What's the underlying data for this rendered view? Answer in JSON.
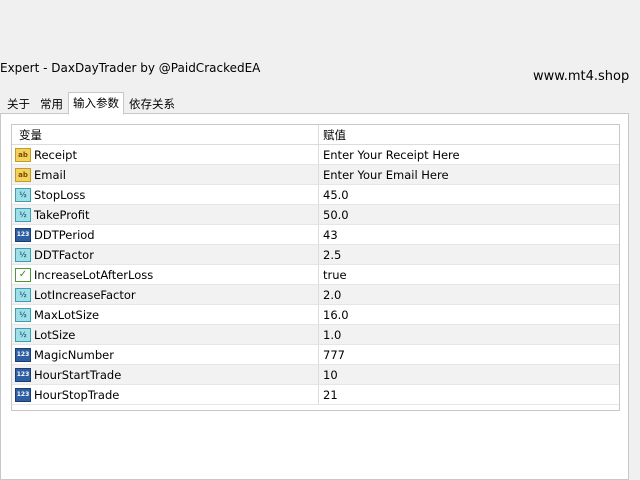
{
  "window": {
    "title": "Expert - DaxDayTrader by @PaidCrackedEA",
    "watermark": "www.mt4.shop"
  },
  "tabs": [
    {
      "label": "关于",
      "active": false
    },
    {
      "label": "常用",
      "active": false
    },
    {
      "label": "输入参数",
      "active": true
    },
    {
      "label": "依存关系",
      "active": false
    }
  ],
  "table": {
    "headers": {
      "variable": "变量",
      "value": "赋值"
    },
    "rows": [
      {
        "name": "Receipt",
        "value": "Enter Your Receipt Here",
        "type": "string",
        "icon": "ab"
      },
      {
        "name": "Email",
        "value": "Enter Your Email Here",
        "type": "string",
        "icon": "ab"
      },
      {
        "name": "StopLoss",
        "value": "45.0",
        "type": "double",
        "icon": "½"
      },
      {
        "name": "TakeProfit",
        "value": "50.0",
        "type": "double",
        "icon": "½"
      },
      {
        "name": "DDTPeriod",
        "value": "43",
        "type": "int",
        "icon": "123"
      },
      {
        "name": "DDTFactor",
        "value": "2.5",
        "type": "double",
        "icon": "½"
      },
      {
        "name": "IncreaseLotAfterLoss",
        "value": "true",
        "type": "bool",
        "icon": "✓"
      },
      {
        "name": "LotIncreaseFactor",
        "value": "2.0",
        "type": "double",
        "icon": "½"
      },
      {
        "name": "MaxLotSize",
        "value": "16.0",
        "type": "double",
        "icon": "½"
      },
      {
        "name": "LotSize",
        "value": "1.0",
        "type": "double",
        "icon": "½"
      },
      {
        "name": "MagicNumber",
        "value": "777",
        "type": "int",
        "icon": "123"
      },
      {
        "name": "HourStartTrade",
        "value": "10",
        "type": "int",
        "icon": "123"
      },
      {
        "name": "HourStopTrade",
        "value": "21",
        "type": "int",
        "icon": "123"
      }
    ]
  }
}
